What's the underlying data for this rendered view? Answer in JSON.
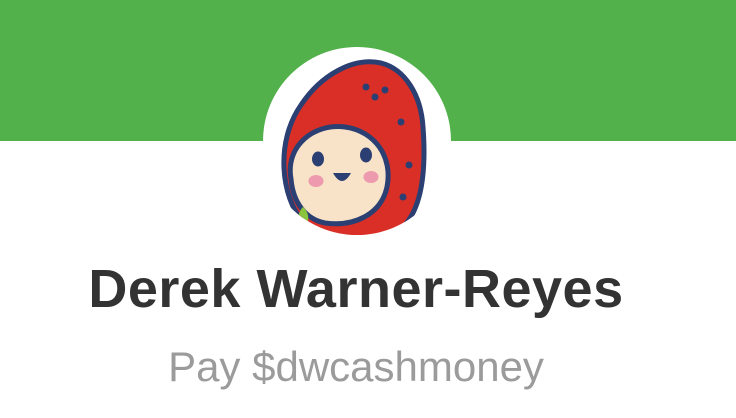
{
  "profile": {
    "name": "Derek Warner-Reyes",
    "pay_line": "Pay $dwcashmoney"
  },
  "avatar": {
    "icon": "strawberry-character-avatar"
  },
  "colors": {
    "banner": "#52b14a",
    "name_text": "#333333",
    "cashtag_text": "#9b9b9b",
    "strawberry_red": "#d92f27",
    "outline_navy": "#2b3f73",
    "face_skin": "#f8e2c8",
    "cheek_pink": "#ee9aae",
    "leaf_green": "#8ac43f"
  }
}
